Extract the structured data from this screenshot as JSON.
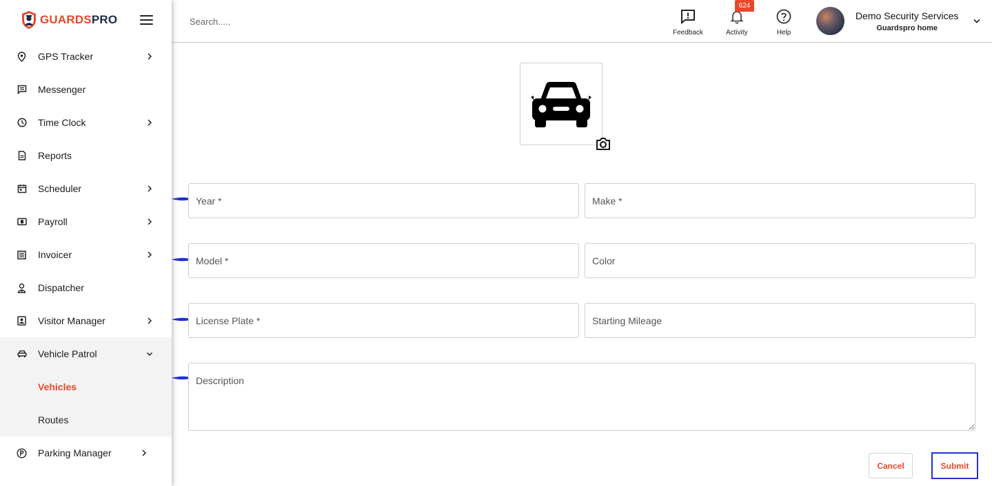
{
  "brand": {
    "logo_part1": "GUARDS",
    "logo_part2": "PRO",
    "accent": "#e8472b",
    "navy": "#1d2a4a"
  },
  "sidebar": {
    "items": [
      {
        "label": "GPS Tracker",
        "icon": "location-pin-icon",
        "has_children": true
      },
      {
        "label": "Messenger",
        "icon": "message-icon",
        "has_children": false
      },
      {
        "label": "Time Clock",
        "icon": "clock-icon",
        "has_children": true
      },
      {
        "label": "Reports",
        "icon": "document-icon",
        "has_children": false
      },
      {
        "label": "Scheduler",
        "icon": "calendar-icon",
        "has_children": true
      },
      {
        "label": "Payroll",
        "icon": "payroll-icon",
        "has_children": true
      },
      {
        "label": "Invoicer",
        "icon": "invoice-icon",
        "has_children": true
      },
      {
        "label": "Dispatcher",
        "icon": "dispatcher-icon",
        "has_children": false
      },
      {
        "label": "Visitor Manager",
        "icon": "visitor-badge-icon",
        "has_children": true
      },
      {
        "label": "Vehicle Patrol",
        "icon": "car-icon",
        "has_children": true,
        "expanded": true
      },
      {
        "label": "Parking Manager",
        "icon": "parking-icon",
        "has_children": true
      }
    ],
    "vehicle_patrol_children": [
      {
        "label": "Vehicles",
        "active": true
      },
      {
        "label": "Routes",
        "active": false
      }
    ]
  },
  "header": {
    "search_placeholder": "Search.....",
    "feedback_label": "Feedback",
    "activity_label": "Activity",
    "activity_count": "624",
    "help_label": "Help",
    "user_name": "Demo Security Services",
    "user_sub": "Guardspro home"
  },
  "form": {
    "year_placeholder": "Year *",
    "make_placeholder": "Make *",
    "model_placeholder": "Model *",
    "color_placeholder": "Color",
    "license_placeholder": "License Plate *",
    "mileage_placeholder": "Starting Mileage",
    "description_placeholder": "Description",
    "cancel_label": "Cancel",
    "submit_label": "Submit"
  }
}
